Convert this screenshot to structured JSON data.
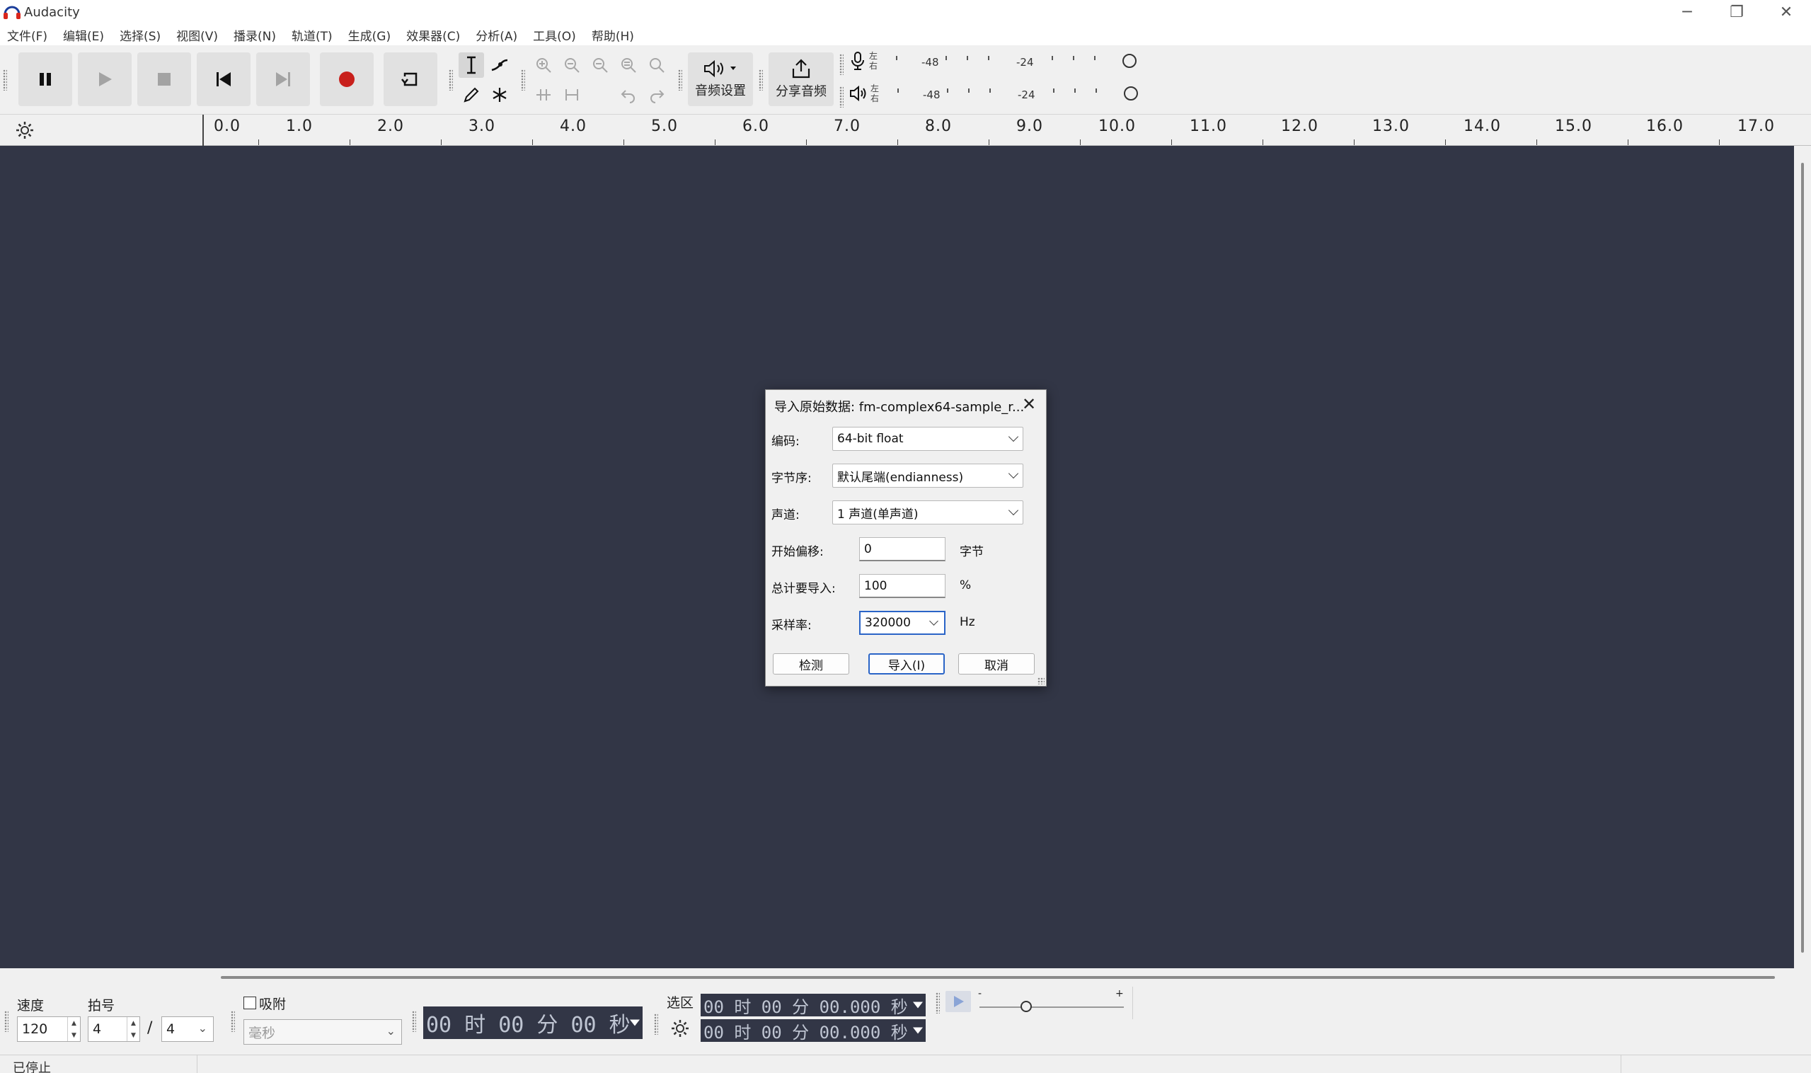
{
  "app": {
    "title": "Audacity",
    "minimize_glyph": "─",
    "maximize_glyph": "❐",
    "close_glyph": "✕"
  },
  "menu": [
    "文件(F)",
    "编辑(E)",
    "选择(S)",
    "视图(V)",
    "播录(N)",
    "轨道(T)",
    "生成(G)",
    "效果器(C)",
    "分析(A)",
    "工具(O)",
    "帮助(H)"
  ],
  "toolbar": {
    "audio_setup_label": "音频设置",
    "share_audio_label": "分享音频",
    "meter_left": "左",
    "meter_right": "右",
    "meter_ticks": [
      "-48",
      "-24"
    ]
  },
  "ruler": {
    "labels": [
      "0.0",
      "1.0",
      "2.0",
      "3.0",
      "4.0",
      "5.0",
      "6.0",
      "7.0",
      "8.0",
      "9.0",
      "10.0",
      "11.0",
      "12.0",
      "13.0",
      "14.0",
      "15.0",
      "16.0",
      "17.0"
    ]
  },
  "dialog": {
    "title": "导入原始数据: fm-complex64-sample_r...",
    "close_glyph": "✕",
    "encoding_label": "编码:",
    "encoding_value": "64-bit float",
    "byte_order_label": "字节序:",
    "byte_order_value": "默认尾端(endianness)",
    "channels_label": "声道:",
    "channels_value": "1 声道(单声道)",
    "offset_label": "开始偏移:",
    "offset_value": "0",
    "offset_unit": "字节",
    "amount_label": "总计要导入:",
    "amount_value": "100",
    "amount_unit": "%",
    "rate_label": "采样率:",
    "rate_value": "320000",
    "rate_unit": "Hz",
    "detect_button": "检测",
    "import_button": "导入(I)",
    "cancel_button": "取消"
  },
  "bottom": {
    "tempo_label": "速度",
    "tempo_value": "120",
    "timesig_label": "拍号",
    "timesig_num": "4",
    "timesig_slash": "/",
    "timesig_den": "4",
    "snap_label": "吸附",
    "snap_unit": "毫秒",
    "time_display": "00 时 00 分 00 秒",
    "selection_label": "选区",
    "sel_start": "00 时 00 分 00.000 秒",
    "sel_end": "00 时 00 分 00.000 秒",
    "speed_minus": "-",
    "speed_plus": "+"
  },
  "status": {
    "text": "已停止"
  }
}
